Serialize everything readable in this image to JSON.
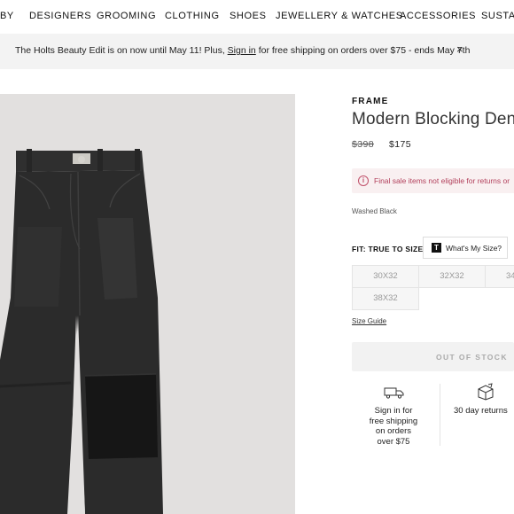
{
  "nav": {
    "items": [
      "BY",
      "DESIGNERS",
      "GROOMING",
      "CLOTHING",
      "SHOES",
      "JEWELLERY & WATCHES",
      "ACCESSORIES",
      "SUSTAIN"
    ]
  },
  "promo": {
    "text_before": "The Holts Beauty Edit is on now until May 11! Plus, ",
    "link": "Sign in",
    "text_after": " for free shipping on orders over $75 - ends May 7th",
    "close_glyph": "×"
  },
  "product": {
    "brand": "FRAME",
    "title": "Modern Blocking Den",
    "original_price": "$398",
    "sale_price": "$175",
    "final_sale": "Final sale items not eligible for returns or",
    "color": "Washed Black",
    "fit_label": "FIT: TRUE TO SIZE",
    "size_help_icon": "T",
    "size_help_label": "What's My Size?",
    "sizes": [
      "30X32",
      "32X32",
      "34",
      "38X32"
    ],
    "size_guide": "Size Guide",
    "stock_button": "OUT OF STOCK"
  },
  "benefits": {
    "shipping_icon": "truck-icon",
    "shipping_lines": [
      "Sign in for",
      "free shipping",
      "on orders",
      "over $75"
    ],
    "returns_icon": "box-icon",
    "returns_text": "30 day returns"
  },
  "colors": {
    "promo_bg": "#f3f3f3",
    "image_bg": "#e2e0df",
    "denim": "#2b2b2b",
    "alert_bg": "#f9f0f1",
    "alert_text": "#b2405c"
  }
}
